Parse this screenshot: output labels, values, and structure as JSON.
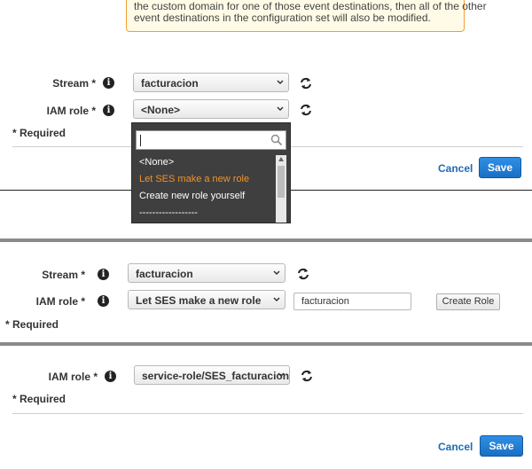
{
  "warning": {
    "line1": "the custom domain for one of those event destinations, then all of the other",
    "line2": "event destinations in the configuration set will also be modified."
  },
  "panel1": {
    "stream_label": "Stream *",
    "stream_value": "facturacion",
    "iam_label": "IAM role *",
    "iam_value": "<None>",
    "required": "* Required",
    "dropdown": {
      "search_value": "",
      "options": [
        "<None>",
        "Let SES make a new role",
        "Create new role yourself",
        "------------------"
      ],
      "highlighted": "Let SES make a new role"
    },
    "cancel": "Cancel",
    "save": "Save"
  },
  "panel2": {
    "stream_label": "Stream *",
    "stream_value": "facturacion",
    "iam_label": "IAM role *",
    "iam_value": "Let SES make a new role",
    "role_name_value": "facturacion",
    "create_role": "Create Role",
    "required": "* Required"
  },
  "panel3": {
    "iam_label": "IAM role *",
    "iam_value": "service-role/SES_facturacion",
    "required": "* Required",
    "cancel": "Cancel",
    "save": "Save"
  },
  "icons": {
    "info": "info-icon",
    "refresh": "refresh-icon",
    "chevron": "chevron-down-icon",
    "search": "search-icon"
  },
  "colors": {
    "primary_button": "#1a6fc4",
    "link": "#1f6bb5",
    "highlight_option": "#f0922a",
    "warning_border": "#f0a030"
  }
}
